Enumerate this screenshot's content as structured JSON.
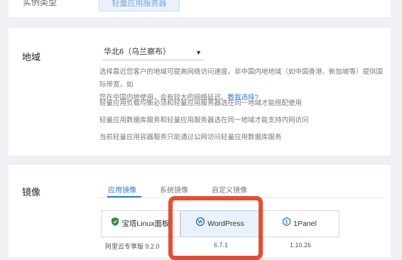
{
  "top": {
    "label": "实例类型",
    "button_label": "轻量应用服务器"
  },
  "region": {
    "label": "地域",
    "select_value": "华北6（乌兰察布）",
    "desc_line1": "选择靠近您客户的地域可提高网络访问速度。非中国内地地域（如中国香港、新加坡等）提供国际带宽，如",
    "desc_line2_prefix": "您在中国内地使用，会有较大的网络延迟。",
    "desc_line2_link": "教我选择?",
    "desc_line3": "轻量应用负载均衡必须和轻量应用服务器选在同一地域才能搭配使用",
    "desc_line4": "轻量应用数据库服务和轻量应用服务器选在同一地域才能支持内网访问",
    "desc_line5": "当前轻量应用容器服务只能通过公网访问轻量应用数据库服务"
  },
  "image": {
    "label": "镜像",
    "tabs": [
      "应用镜像",
      "系统镜像",
      "自定义镜像"
    ],
    "cards": [
      {
        "name": "宝塔Linux面板",
        "icon": "shield-icon",
        "version": "阿里云专享版 9.2.0"
      },
      {
        "name": "WordPress",
        "icon": "wordpress-icon",
        "version": "6.7.1"
      },
      {
        "name": "1Panel",
        "icon": "1panel-icon",
        "version": "1.10.26"
      }
    ]
  },
  "colors": {
    "accent": "#2f7ad6",
    "highlight": "#ec4a2e",
    "background": "#eef0f4"
  }
}
